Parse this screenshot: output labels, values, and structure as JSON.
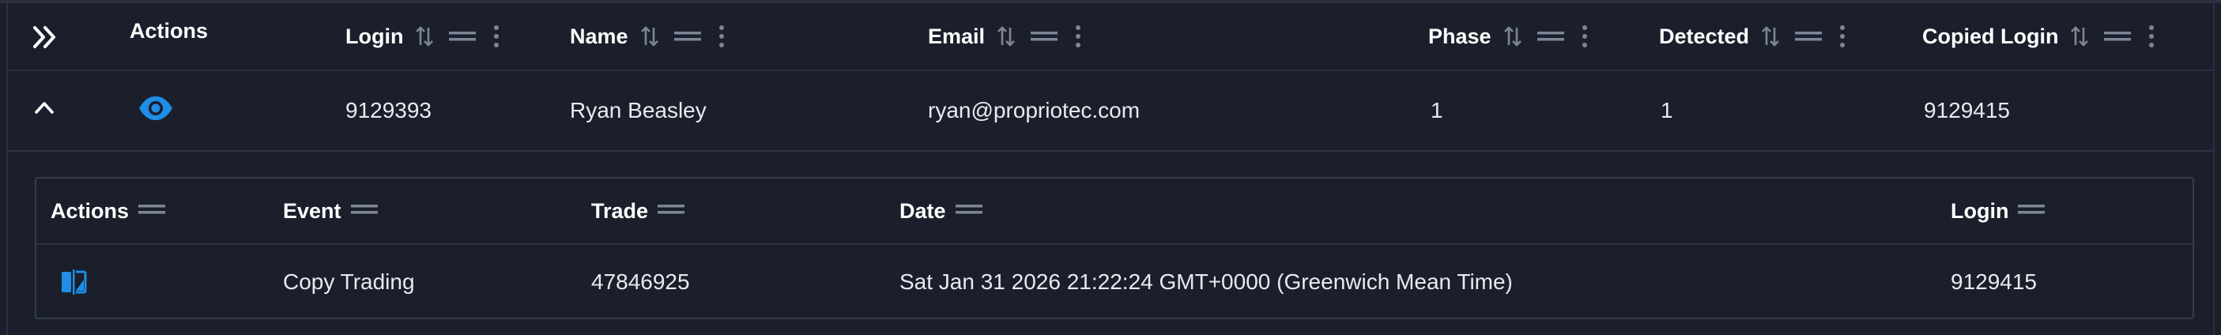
{
  "colors": {
    "background": "#1a1f2b",
    "accent": "#1e8ee6",
    "header_text": "#ffffff",
    "muted_icon": "#7d8596",
    "divider": "#2c3242"
  },
  "main_table": {
    "columns": [
      {
        "key": "actions",
        "label": "Actions"
      },
      {
        "key": "login",
        "label": "Login"
      },
      {
        "key": "name",
        "label": "Name"
      },
      {
        "key": "email",
        "label": "Email"
      },
      {
        "key": "phase",
        "label": "Phase"
      },
      {
        "key": "detected",
        "label": "Detected"
      },
      {
        "key": "copied_login",
        "label": "Copied Login"
      }
    ],
    "icons": {
      "expand_all": "double-chevron-right-icon",
      "collapse_row": "chevron-up-icon",
      "view": "eye-icon",
      "sort": "sort-arrows-icon",
      "column_menu": "drag-handle-icon",
      "column_actions": "kebab-icon"
    },
    "rows": [
      {
        "login": "9129393",
        "name": "Ryan Beasley",
        "email": "ryan@propriotec.com",
        "phase": "1",
        "detected": "1",
        "copied_login": "9129415"
      }
    ]
  },
  "detail_table": {
    "columns": [
      {
        "key": "actions",
        "label": "Actions"
      },
      {
        "key": "event",
        "label": "Event"
      },
      {
        "key": "trade",
        "label": "Trade"
      },
      {
        "key": "date",
        "label": "Date"
      },
      {
        "key": "login",
        "label": "Login"
      }
    ],
    "icons": {
      "compare": "compare-icon",
      "column_menu": "drag-handle-icon"
    },
    "rows": [
      {
        "event": "Copy Trading",
        "trade": "47846925",
        "date": "Sat Jan 31 2026 21:22:24 GMT+0000 (Greenwich Mean Time)",
        "login": "9129415"
      }
    ]
  }
}
